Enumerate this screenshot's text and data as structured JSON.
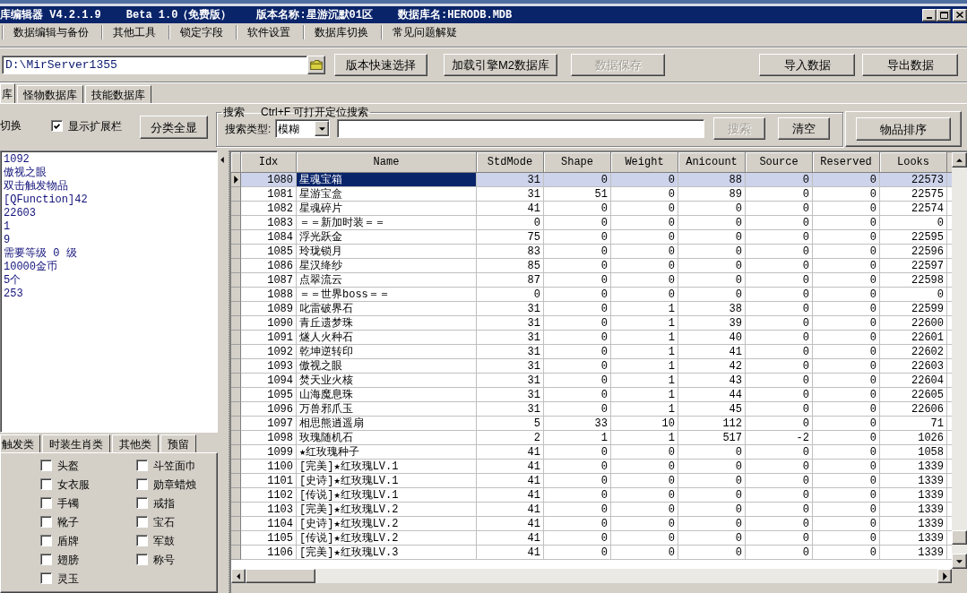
{
  "window": {
    "title_parts": [
      "库编辑器 V4.2.1.9",
      "Beta 1.0（免费版）",
      "版本名称:星游沉默01区",
      "数据库名:HERODB.MDB"
    ]
  },
  "menu": [
    "数据编辑与备份",
    "其他工具",
    "锁定字段",
    "软件设置",
    "数据库切换",
    "常见问题解疑"
  ],
  "toolbar": {
    "path": "D:\\MirServer1355",
    "buttons": [
      {
        "label": "版本快速选择",
        "disabled": false
      },
      {
        "label": "加载引擎M2数据库",
        "disabled": false
      },
      {
        "label": "数据保存",
        "disabled": true
      },
      {
        "label": "导入数据",
        "disabled": false
      },
      {
        "label": "导出数据",
        "disabled": false
      }
    ]
  },
  "tabs": [
    {
      "label": "库",
      "selected": true
    },
    {
      "label": "怪物数据库",
      "selected": false
    },
    {
      "label": "技能数据库",
      "selected": false
    }
  ],
  "filter": {
    "label": "切换",
    "show_extension": {
      "label": "显示扩展栏",
      "checked": true
    },
    "show_all_button": "分类全显"
  },
  "search": {
    "legend": [
      "搜索",
      "Ctrl+F 可打开定位搜索"
    ],
    "type_label": "搜索类型:",
    "type_value": "模糊",
    "buttons": [
      {
        "label": "搜索",
        "disabled": true
      },
      {
        "label": "清空",
        "disabled": false
      }
    ]
  },
  "sort_button": "物品排序",
  "details": [
    "1092",
    "傲视之眼",
    "双击触发物品",
    "[QFunction]42",
    "22603",
    "1",
    "9",
    "需要等级 0 级",
    "10000金币",
    "5个",
    "253"
  ],
  "category_tabs": [
    {
      "label": "触发类",
      "selected": false
    },
    {
      "label": "时装生肖类",
      "selected": false
    },
    {
      "label": "其他类",
      "selected": false
    },
    {
      "label": "预留",
      "selected": false
    }
  ],
  "categories": [
    {
      "label": "头盔",
      "checked": false
    },
    {
      "label": "斗笠面巾",
      "checked": false
    },
    {
      "label": "女衣服",
      "checked": false
    },
    {
      "label": "勋章蜡烛",
      "checked": false
    },
    {
      "label": "手镯",
      "checked": false
    },
    {
      "label": "戒指",
      "checked": false
    },
    {
      "label": "靴子",
      "checked": false
    },
    {
      "label": "宝石",
      "checked": false
    },
    {
      "label": "盾牌",
      "checked": false
    },
    {
      "label": "军鼓",
      "checked": false
    },
    {
      "label": "翅膀",
      "checked": false
    },
    {
      "label": "称号",
      "checked": false
    },
    {
      "label": "灵玉",
      "checked": false
    }
  ],
  "table": {
    "columns": [
      "Idx",
      "Name",
      "StdMode",
      "Shape",
      "Weight",
      "Anicount",
      "Source",
      "Reserved",
      "Looks"
    ],
    "rows": [
      {
        "selected": true,
        "cells": [
          "1080",
          "星魂宝箱",
          "31",
          "0",
          "0",
          "88",
          "0",
          "0",
          "22573"
        ]
      },
      {
        "selected": false,
        "cells": [
          "1081",
          "星游宝盒",
          "31",
          "51",
          "0",
          "89",
          "0",
          "0",
          "22575"
        ]
      },
      {
        "selected": false,
        "cells": [
          "1082",
          "星魂碎片",
          "41",
          "0",
          "0",
          "0",
          "0",
          "0",
          "22574"
        ]
      },
      {
        "selected": false,
        "cells": [
          "1083",
          "＝＝新加时装＝＝",
          "0",
          "0",
          "0",
          "0",
          "0",
          "0",
          "0"
        ]
      },
      {
        "selected": false,
        "cells": [
          "1084",
          "浮光跃金",
          "75",
          "0",
          "0",
          "0",
          "0",
          "0",
          "22595"
        ]
      },
      {
        "selected": false,
        "cells": [
          "1085",
          "玲珑锁月",
          "83",
          "0",
          "0",
          "0",
          "0",
          "0",
          "22596"
        ]
      },
      {
        "selected": false,
        "cells": [
          "1086",
          "星汉绛纱",
          "85",
          "0",
          "0",
          "0",
          "0",
          "0",
          "22597"
        ]
      },
      {
        "selected": false,
        "cells": [
          "1087",
          "点翠流云",
          "87",
          "0",
          "0",
          "0",
          "0",
          "0",
          "22598"
        ]
      },
      {
        "selected": false,
        "cells": [
          "1088",
          "＝＝世界boss＝＝",
          "0",
          "0",
          "0",
          "0",
          "0",
          "0",
          "0"
        ]
      },
      {
        "selected": false,
        "cells": [
          "1089",
          "叱雷破界石",
          "31",
          "0",
          "1",
          "38",
          "0",
          "0",
          "22599"
        ]
      },
      {
        "selected": false,
        "cells": [
          "1090",
          "青丘遗梦珠",
          "31",
          "0",
          "1",
          "39",
          "0",
          "0",
          "22600"
        ]
      },
      {
        "selected": false,
        "cells": [
          "1091",
          "燧人火种石",
          "31",
          "0",
          "1",
          "40",
          "0",
          "0",
          "22601"
        ]
      },
      {
        "selected": false,
        "cells": [
          "1092",
          "乾坤逆转印",
          "31",
          "0",
          "1",
          "41",
          "0",
          "0",
          "22602"
        ]
      },
      {
        "selected": false,
        "cells": [
          "1093",
          "傲视之眼",
          "31",
          "0",
          "1",
          "42",
          "0",
          "0",
          "22603"
        ]
      },
      {
        "selected": false,
        "cells": [
          "1094",
          "焚天业火核",
          "31",
          "0",
          "1",
          "43",
          "0",
          "0",
          "22604"
        ]
      },
      {
        "selected": false,
        "cells": [
          "1095",
          "山海魔息珠",
          "31",
          "0",
          "1",
          "44",
          "0",
          "0",
          "22605"
        ]
      },
      {
        "selected": false,
        "cells": [
          "1096",
          "万兽邪爪玉",
          "31",
          "0",
          "1",
          "45",
          "0",
          "0",
          "22606"
        ]
      },
      {
        "selected": false,
        "cells": [
          "1097",
          "相思熊逍遥扇",
          "5",
          "33",
          "10",
          "112",
          "0",
          "0",
          "71"
        ]
      },
      {
        "selected": false,
        "cells": [
          "1098",
          "玫瑰随机石",
          "2",
          "1",
          "1",
          "517",
          "-2",
          "0",
          "1026"
        ]
      },
      {
        "selected": false,
        "cells": [
          "1099",
          "★红玫瑰种子",
          "41",
          "0",
          "0",
          "0",
          "0",
          "0",
          "1058"
        ]
      },
      {
        "selected": false,
        "cells": [
          "1100",
          "[完美]★红玫瑰LV.1",
          "41",
          "0",
          "0",
          "0",
          "0",
          "0",
          "1339"
        ]
      },
      {
        "selected": false,
        "cells": [
          "1101",
          "[史诗]★红玫瑰LV.1",
          "41",
          "0",
          "0",
          "0",
          "0",
          "0",
          "1339"
        ]
      },
      {
        "selected": false,
        "cells": [
          "1102",
          "[传说]★红玫瑰LV.1",
          "41",
          "0",
          "0",
          "0",
          "0",
          "0",
          "1339"
        ]
      },
      {
        "selected": false,
        "cells": [
          "1103",
          "[完美]★红玫瑰LV.2",
          "41",
          "0",
          "0",
          "0",
          "0",
          "0",
          "1339"
        ]
      },
      {
        "selected": false,
        "cells": [
          "1104",
          "[史诗]★红玫瑰LV.2",
          "41",
          "0",
          "0",
          "0",
          "0",
          "0",
          "1339"
        ]
      },
      {
        "selected": false,
        "cells": [
          "1105",
          "[传说]★红玫瑰LV.2",
          "41",
          "0",
          "0",
          "0",
          "0",
          "0",
          "1339"
        ]
      },
      {
        "selected": false,
        "cells": [
          "1106",
          "[完美]★红玫瑰LV.3",
          "41",
          "0",
          "0",
          "0",
          "0",
          "0",
          "1339"
        ]
      }
    ]
  }
}
